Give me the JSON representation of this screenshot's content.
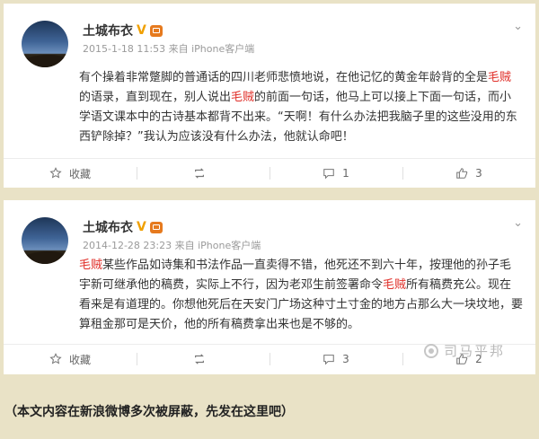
{
  "posts": [
    {
      "username": "土城布衣",
      "verified_mark": "V",
      "timestamp": "2015-1-18 11:53",
      "source": "来自 iPhone客户端",
      "text_segments": [
        {
          "t": "有个操着非常蹩脚的普通话的四川老师悲愤地说，在他记忆的黄金年龄背的全是",
          "hl": false
        },
        {
          "t": "毛贼",
          "hl": true
        },
        {
          "t": "的语录，直到现在，别人说出",
          "hl": false
        },
        {
          "t": "毛贼",
          "hl": true
        },
        {
          "t": "的前面一句话，他马上可以接上下面一句话，而小学语文课本中的古诗基本都背不出来。“天啊！有什么办法把我脑子里的这些没用的东西铲除掉？”我认为应该没有什么办法，他就认命吧！",
          "hl": false
        }
      ],
      "actions": {
        "favorite": "收藏",
        "repost": "",
        "comment": "1",
        "like": "3"
      }
    },
    {
      "username": "土城布衣",
      "verified_mark": "V",
      "timestamp": "2014-12-28 23:23",
      "source": "来自 iPhone客户端",
      "text_segments": [
        {
          "t": "毛贼",
          "hl": true
        },
        {
          "t": "某些作品如诗集和书法作品一直卖得不错，他死还不到六十年，按理他的孙子毛宇新可继承他的稿费，实际上不行，因为老邓生前签署命令",
          "hl": false
        },
        {
          "t": "毛贼",
          "hl": true
        },
        {
          "t": "所有稿费充公。现在看来是有道理的。你想他死后在天安门广场这种寸土寸金的地方占那么大一块坟地，要算租金那可是天价，他的所有稿费拿出来也是不够的。",
          "hl": false
        }
      ],
      "actions": {
        "favorite": "收藏",
        "repost": "",
        "comment": "3",
        "like": "2"
      }
    }
  ],
  "watermark": "司马平邦",
  "footer_note": "（本文内容在新浪微博多次被屏蔽，先发在这里吧）",
  "colors": {
    "highlight": "#e0302a",
    "verified": "#f0a000",
    "background": "#e9e2c6"
  }
}
